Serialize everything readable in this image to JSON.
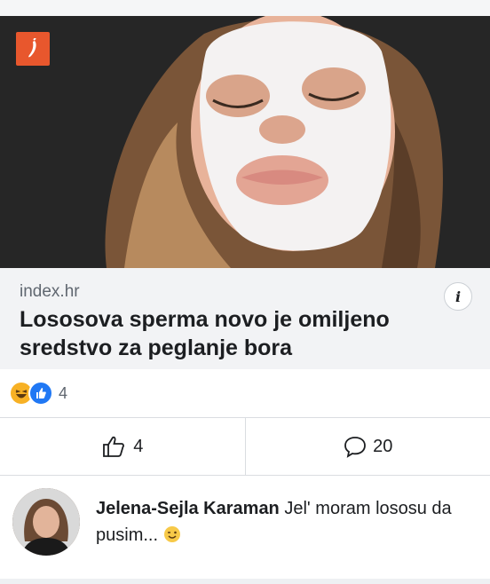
{
  "post": {
    "image_alt": "Woman with white sheet face mask",
    "brand_icon": "pepper-logo-icon",
    "source": "index.hr",
    "headline": "Lososova sperma novo je omiljeno sredstvo za peglanje bora",
    "info_icon": "info-icon"
  },
  "reactions": {
    "icons": [
      "haha-reaction-icon",
      "like-reaction-icon"
    ],
    "count": "4"
  },
  "actions": {
    "like_count": "4",
    "comment_count": "20"
  },
  "comment": {
    "author": "Jelena-Sejla Karaman",
    "text": " Jel' moram lososu da pusim...",
    "emoji": "wink-emoji-icon"
  },
  "colors": {
    "brand": "#e8572d",
    "like_blue": "#2078f4",
    "haha_yellow": "#f7b125"
  }
}
